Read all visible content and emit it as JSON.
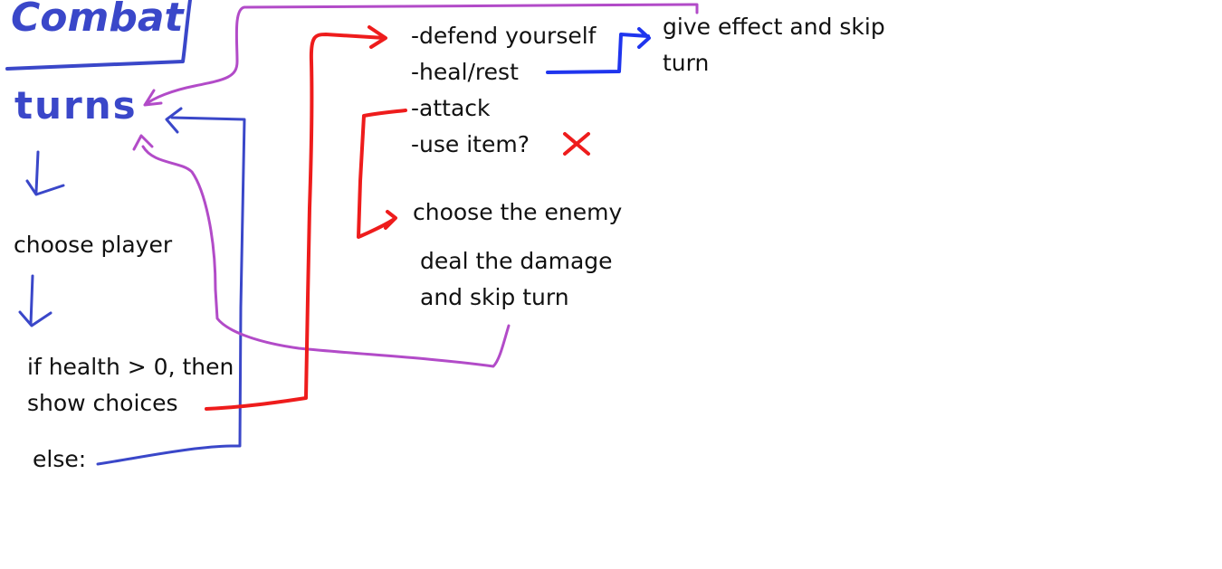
{
  "handwriting": {
    "title": "Combat",
    "turns": "turns"
  },
  "nodes": {
    "choose_player": "choose player",
    "condition": [
      "if health > 0, then",
      "show choices"
    ],
    "else": "else:",
    "choices": [
      "-defend yourself",
      "-heal/rest",
      "-attack",
      "-use item?"
    ],
    "effect": [
      "give effect and skip",
      "turn"
    ],
    "choose_enemy": "choose the enemy",
    "damage": [
      "deal the damage",
      "and skip turn"
    ]
  },
  "colors": {
    "blue": "#3a47c9",
    "bright_blue": "#1f35ee",
    "red": "#ee1c1c",
    "purple": "#b24bc8",
    "text": "#111111"
  },
  "icons": {
    "rejected_mark": "red-x-icon"
  }
}
